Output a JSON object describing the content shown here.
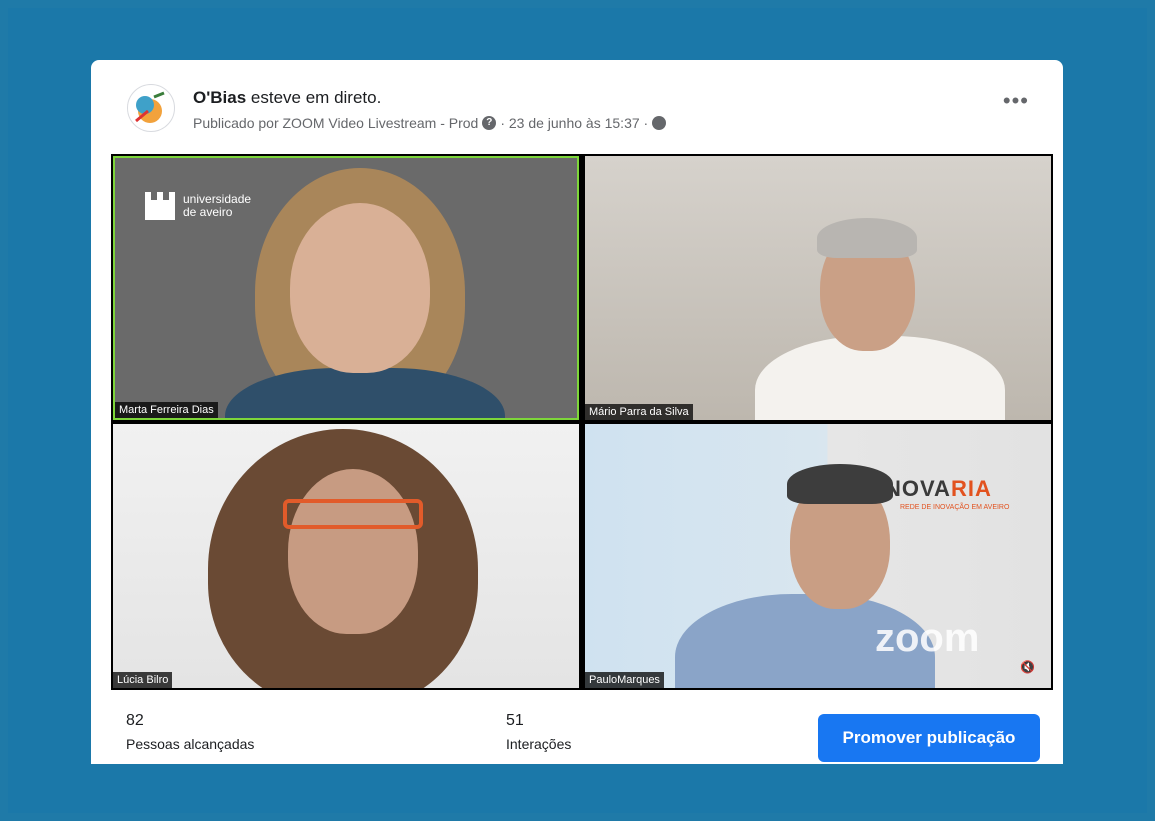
{
  "post": {
    "page_name": "O'Bias",
    "status": "esteve em direto.",
    "published_by": "Publicado por ZOOM Video Livestream - Prod",
    "date": "· 23 de junho às 15:37 ·"
  },
  "video": {
    "participants": [
      {
        "name": "Marta Ferreira Dias",
        "active_speaker": true
      },
      {
        "name": "Mário Parra da Silva"
      },
      {
        "name": "Lúcia Bilro"
      },
      {
        "name": "PauloMarques"
      }
    ],
    "branding": {
      "university_line1": "universidade",
      "university_line2": "de aveiro",
      "inovaria_main": "NOVA",
      "inovaria_accent": "RIA",
      "inovaria_tagline": "REDE DE INOVAÇÃO EM AVEIRO",
      "zoom_watermark": "zoom"
    }
  },
  "stats": {
    "reach_count": "82",
    "reach_label": "Pessoas alcançadas",
    "interactions_count": "51",
    "interactions_label": "Interações"
  },
  "actions": {
    "promote_label": "Promover publicação",
    "more_label": "•••"
  },
  "colors": {
    "background": "#1b78a9",
    "primary_button": "#1877f2",
    "active_speaker_border": "#7dd63a"
  }
}
